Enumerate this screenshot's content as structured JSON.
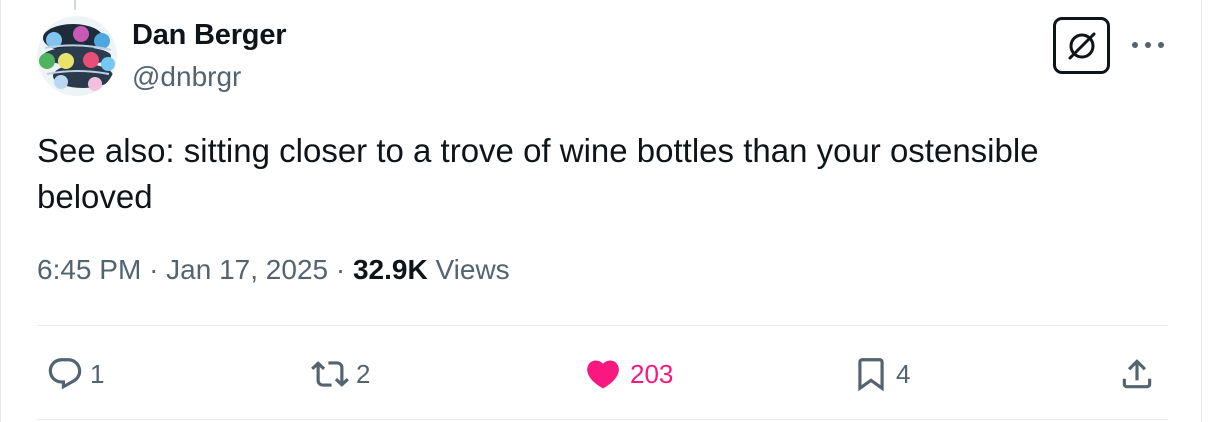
{
  "author": {
    "name": "Dan Berger",
    "handle": "@dnbrgr"
  },
  "tweet": {
    "text": "See also: sitting closer to a trove of wine bottles than your ostensible\nbeloved",
    "time": "6:45 PM",
    "separator": "·",
    "date": "Jan 17, 2025",
    "views_count": "32.9K",
    "views_label": "Views"
  },
  "actions": {
    "replies": "1",
    "reposts": "2",
    "likes": "203",
    "bookmarks": "4"
  },
  "colors": {
    "text": "#0f1419",
    "secondary": "#536471",
    "like": "#f91880",
    "divider": "#e7ebee"
  },
  "icons": [
    "grok-icon",
    "more-icon",
    "reply-icon",
    "repost-icon",
    "heart-icon",
    "bookmark-icon",
    "share-icon"
  ]
}
